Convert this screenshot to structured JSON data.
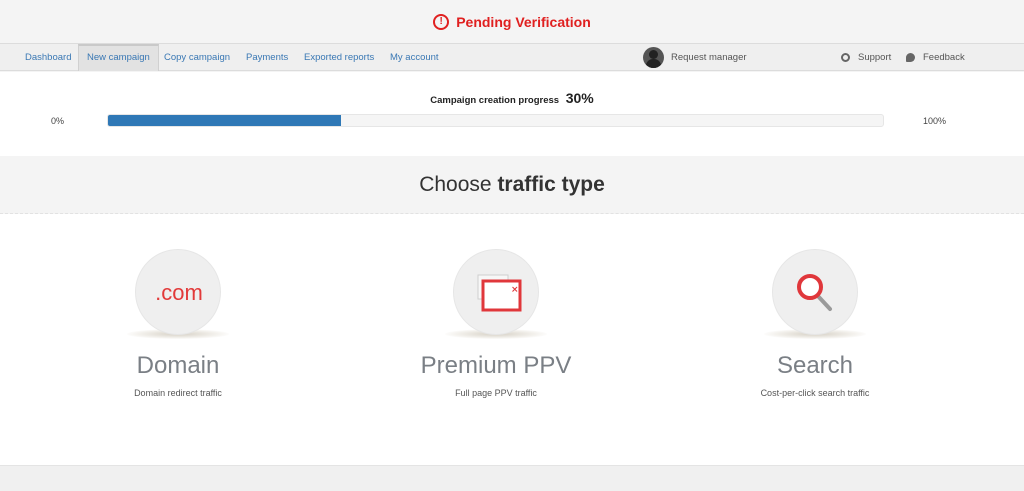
{
  "banner": {
    "text": "Pending Verification",
    "icon": "alert-circle-icon",
    "color": "#e02020"
  },
  "nav": {
    "items": [
      {
        "label": "Dashboard"
      },
      {
        "label": "New campaign",
        "active": true
      },
      {
        "label": "Copy campaign"
      },
      {
        "label": "Payments"
      },
      {
        "label": "Exported reports"
      },
      {
        "label": "My account"
      }
    ],
    "request_manager": "Request manager",
    "support": "Support",
    "feedback": "Feedback"
  },
  "progress": {
    "title": "Campaign creation progress",
    "percent_label": "30%",
    "value": 0.3,
    "min_label": "0%",
    "max_label": "100%",
    "color": "#2f78b6"
  },
  "heading": {
    "prefix": "Choose",
    "bold": "traffic type"
  },
  "cards": [
    {
      "title": "Domain",
      "subtitle": "Domain redirect traffic",
      "icon": ".com"
    },
    {
      "title": "Premium PPV",
      "subtitle": "Full page PPV traffic",
      "icon": "popup-window-icon"
    },
    {
      "title": "Search",
      "subtitle": "Cost-per-click search traffic",
      "icon": "magnifier-icon"
    }
  ]
}
